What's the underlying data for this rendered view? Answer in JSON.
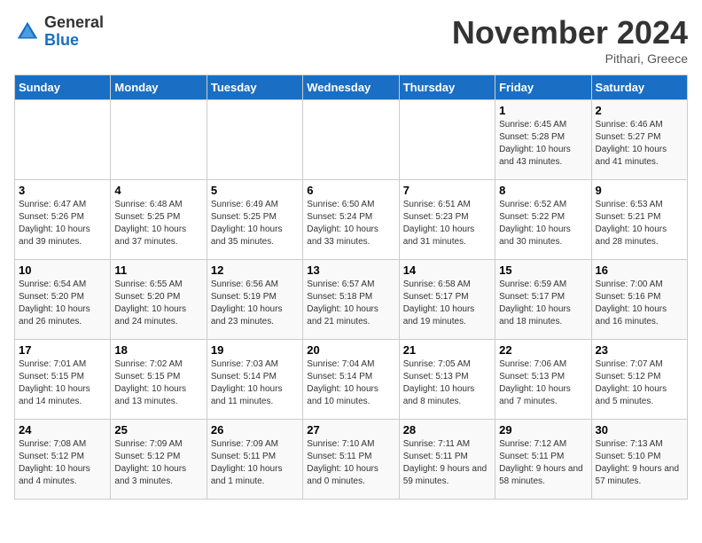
{
  "header": {
    "logo_general": "General",
    "logo_blue": "Blue",
    "month_title": "November 2024",
    "location": "Pithari, Greece"
  },
  "days_of_week": [
    "Sunday",
    "Monday",
    "Tuesday",
    "Wednesday",
    "Thursday",
    "Friday",
    "Saturday"
  ],
  "weeks": [
    [
      {
        "day": "",
        "info": ""
      },
      {
        "day": "",
        "info": ""
      },
      {
        "day": "",
        "info": ""
      },
      {
        "day": "",
        "info": ""
      },
      {
        "day": "",
        "info": ""
      },
      {
        "day": "1",
        "info": "Sunrise: 6:45 AM\nSunset: 5:28 PM\nDaylight: 10 hours and 43 minutes."
      },
      {
        "day": "2",
        "info": "Sunrise: 6:46 AM\nSunset: 5:27 PM\nDaylight: 10 hours and 41 minutes."
      }
    ],
    [
      {
        "day": "3",
        "info": "Sunrise: 6:47 AM\nSunset: 5:26 PM\nDaylight: 10 hours and 39 minutes."
      },
      {
        "day": "4",
        "info": "Sunrise: 6:48 AM\nSunset: 5:25 PM\nDaylight: 10 hours and 37 minutes."
      },
      {
        "day": "5",
        "info": "Sunrise: 6:49 AM\nSunset: 5:25 PM\nDaylight: 10 hours and 35 minutes."
      },
      {
        "day": "6",
        "info": "Sunrise: 6:50 AM\nSunset: 5:24 PM\nDaylight: 10 hours and 33 minutes."
      },
      {
        "day": "7",
        "info": "Sunrise: 6:51 AM\nSunset: 5:23 PM\nDaylight: 10 hours and 31 minutes."
      },
      {
        "day": "8",
        "info": "Sunrise: 6:52 AM\nSunset: 5:22 PM\nDaylight: 10 hours and 30 minutes."
      },
      {
        "day": "9",
        "info": "Sunrise: 6:53 AM\nSunset: 5:21 PM\nDaylight: 10 hours and 28 minutes."
      }
    ],
    [
      {
        "day": "10",
        "info": "Sunrise: 6:54 AM\nSunset: 5:20 PM\nDaylight: 10 hours and 26 minutes."
      },
      {
        "day": "11",
        "info": "Sunrise: 6:55 AM\nSunset: 5:20 PM\nDaylight: 10 hours and 24 minutes."
      },
      {
        "day": "12",
        "info": "Sunrise: 6:56 AM\nSunset: 5:19 PM\nDaylight: 10 hours and 23 minutes."
      },
      {
        "day": "13",
        "info": "Sunrise: 6:57 AM\nSunset: 5:18 PM\nDaylight: 10 hours and 21 minutes."
      },
      {
        "day": "14",
        "info": "Sunrise: 6:58 AM\nSunset: 5:17 PM\nDaylight: 10 hours and 19 minutes."
      },
      {
        "day": "15",
        "info": "Sunrise: 6:59 AM\nSunset: 5:17 PM\nDaylight: 10 hours and 18 minutes."
      },
      {
        "day": "16",
        "info": "Sunrise: 7:00 AM\nSunset: 5:16 PM\nDaylight: 10 hours and 16 minutes."
      }
    ],
    [
      {
        "day": "17",
        "info": "Sunrise: 7:01 AM\nSunset: 5:15 PM\nDaylight: 10 hours and 14 minutes."
      },
      {
        "day": "18",
        "info": "Sunrise: 7:02 AM\nSunset: 5:15 PM\nDaylight: 10 hours and 13 minutes."
      },
      {
        "day": "19",
        "info": "Sunrise: 7:03 AM\nSunset: 5:14 PM\nDaylight: 10 hours and 11 minutes."
      },
      {
        "day": "20",
        "info": "Sunrise: 7:04 AM\nSunset: 5:14 PM\nDaylight: 10 hours and 10 minutes."
      },
      {
        "day": "21",
        "info": "Sunrise: 7:05 AM\nSunset: 5:13 PM\nDaylight: 10 hours and 8 minutes."
      },
      {
        "day": "22",
        "info": "Sunrise: 7:06 AM\nSunset: 5:13 PM\nDaylight: 10 hours and 7 minutes."
      },
      {
        "day": "23",
        "info": "Sunrise: 7:07 AM\nSunset: 5:12 PM\nDaylight: 10 hours and 5 minutes."
      }
    ],
    [
      {
        "day": "24",
        "info": "Sunrise: 7:08 AM\nSunset: 5:12 PM\nDaylight: 10 hours and 4 minutes."
      },
      {
        "day": "25",
        "info": "Sunrise: 7:09 AM\nSunset: 5:12 PM\nDaylight: 10 hours and 3 minutes."
      },
      {
        "day": "26",
        "info": "Sunrise: 7:09 AM\nSunset: 5:11 PM\nDaylight: 10 hours and 1 minute."
      },
      {
        "day": "27",
        "info": "Sunrise: 7:10 AM\nSunset: 5:11 PM\nDaylight: 10 hours and 0 minutes."
      },
      {
        "day": "28",
        "info": "Sunrise: 7:11 AM\nSunset: 5:11 PM\nDaylight: 9 hours and 59 minutes."
      },
      {
        "day": "29",
        "info": "Sunrise: 7:12 AM\nSunset: 5:11 PM\nDaylight: 9 hours and 58 minutes."
      },
      {
        "day": "30",
        "info": "Sunrise: 7:13 AM\nSunset: 5:10 PM\nDaylight: 9 hours and 57 minutes."
      }
    ]
  ]
}
